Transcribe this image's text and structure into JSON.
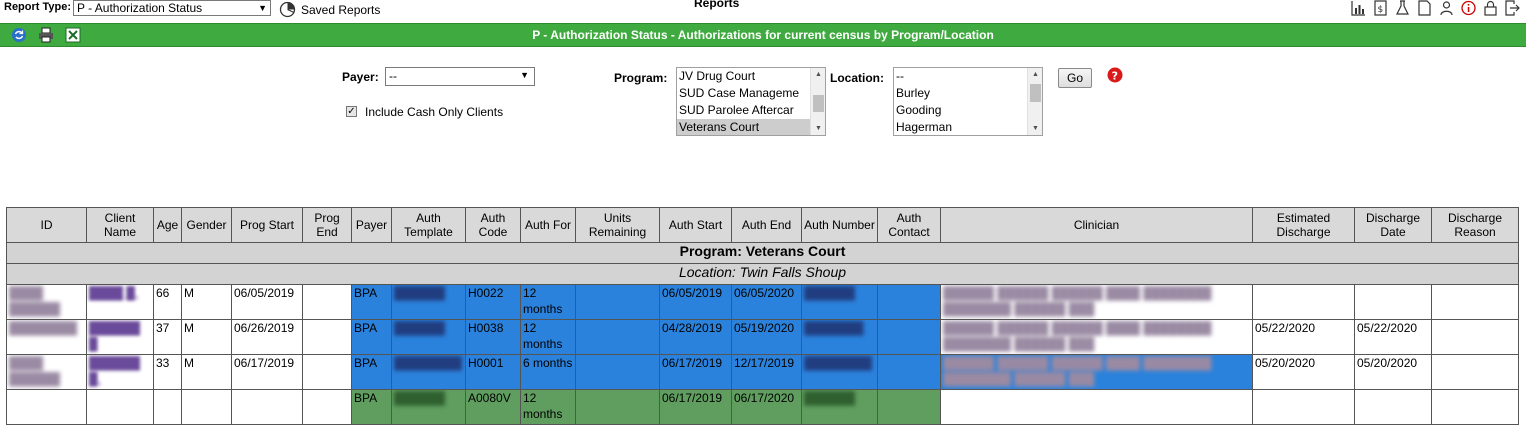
{
  "topbar": {
    "report_type_label": "Report Type:",
    "report_type_value": "P - Authorization Status",
    "saved_reports": "Saved Reports",
    "title": "Reports",
    "icons": [
      "bar-chart-icon",
      "dollar-document-icon",
      "flask-icon",
      "document-icon",
      "person-icon",
      "info-icon",
      "lock-icon",
      "exit-icon"
    ]
  },
  "header": {
    "title": "P - Authorization Status - Authorizations for current census by Program/Location",
    "icons": [
      "refresh-icon",
      "print-icon",
      "excel-icon"
    ],
    "color": "#3faa3f"
  },
  "filters": {
    "payer_label": "Payer:",
    "payer_value": "--",
    "include_cash_label": "Include Cash Only Clients",
    "include_cash_checked": true,
    "program_label": "Program:",
    "programs": [
      "JV Drug Court",
      "SUD Case Manageme",
      "SUD Parolee Aftercar",
      "Veterans Court"
    ],
    "program_selected": "Veterans Court",
    "location_label": "Location:",
    "locations": [
      "--",
      "Burley",
      "Gooding",
      "Hagerman"
    ],
    "go_label": "Go"
  },
  "table": {
    "headers": {
      "id": "ID",
      "client_name": "Client Name",
      "age": "Age",
      "gender": "Gender",
      "prog_start": "Prog Start",
      "prog_end": "Prog End",
      "payer": "Payer",
      "auth_template": "Auth Template",
      "auth_code": "Auth Code",
      "auth_for": "Auth For",
      "units_remaining": "Units Remaining",
      "auth_start": "Auth Start",
      "auth_end": "Auth End",
      "auth_number": "Auth Number",
      "auth_contact": "Auth Contact",
      "clinician": "Clinician",
      "estimated_discharge": "Estimated Discharge",
      "discharge_date": "Discharge Date",
      "discharge_reason": "Discharge Reason"
    },
    "program_group": "Program: Veterans Court",
    "location_group": "Location: Twin Falls Shoup",
    "rows": [
      {
        "age": "66",
        "gender": "M",
        "prog_start": "06/05/2019",
        "payer": "BPA",
        "auth_code": "H0022",
        "auth_for": "12 months",
        "auth_start": "06/05/2019",
        "auth_end": "06/05/2020",
        "est_discharge": "",
        "discharge_date": ""
      },
      {
        "age": "37",
        "gender": "M",
        "prog_start": "06/26/2019",
        "payer": "BPA",
        "auth_code": "H0038",
        "auth_for": "12 months",
        "auth_start": "04/28/2019",
        "auth_end": "05/19/2020",
        "est_discharge": "05/22/2020",
        "discharge_date": "05/22/2020"
      },
      {
        "age": "33",
        "gender": "M",
        "prog_start": "06/17/2019",
        "payer": "BPA",
        "auth_code": "H0001",
        "auth_for": "6 months",
        "auth_start": "06/17/2019",
        "auth_end": "12/17/2019",
        "est_discharge": "05/20/2020",
        "discharge_date": "05/20/2020"
      },
      {
        "age": "",
        "gender": "",
        "prog_start": "",
        "payer": "BPA",
        "auth_code": "A0080V",
        "auth_for": "12 months",
        "auth_start": "06/17/2019",
        "auth_end": "06/17/2020",
        "est_discharge": "",
        "discharge_date": ""
      }
    ],
    "colors": {
      "blue_row": "#2b82dc",
      "green_row": "#5f9e5f",
      "group_bg": "#d3d3d3"
    }
  }
}
